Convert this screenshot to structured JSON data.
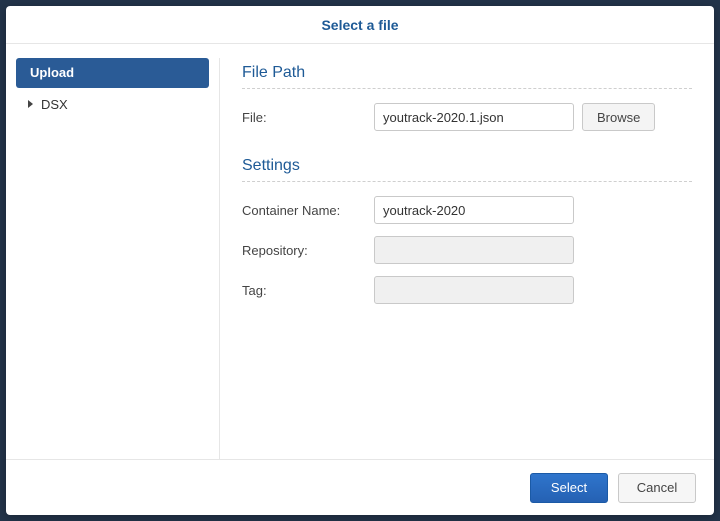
{
  "title": "Select a file",
  "sidebar": {
    "items": [
      {
        "label": "Upload",
        "selected": true
      },
      {
        "label": "DSX",
        "selected": false,
        "expandable": true
      }
    ]
  },
  "sections": {
    "file_path": {
      "title": "File Path",
      "file_label": "File:",
      "file_value": "youtrack-2020.1.json",
      "browse_label": "Browse"
    },
    "settings": {
      "title": "Settings",
      "container_label": "Container Name:",
      "container_value": "youtrack-2020",
      "repository_label": "Repository:",
      "repository_value": "",
      "tag_label": "Tag:",
      "tag_value": ""
    }
  },
  "footer": {
    "select_label": "Select",
    "cancel_label": "Cancel"
  }
}
